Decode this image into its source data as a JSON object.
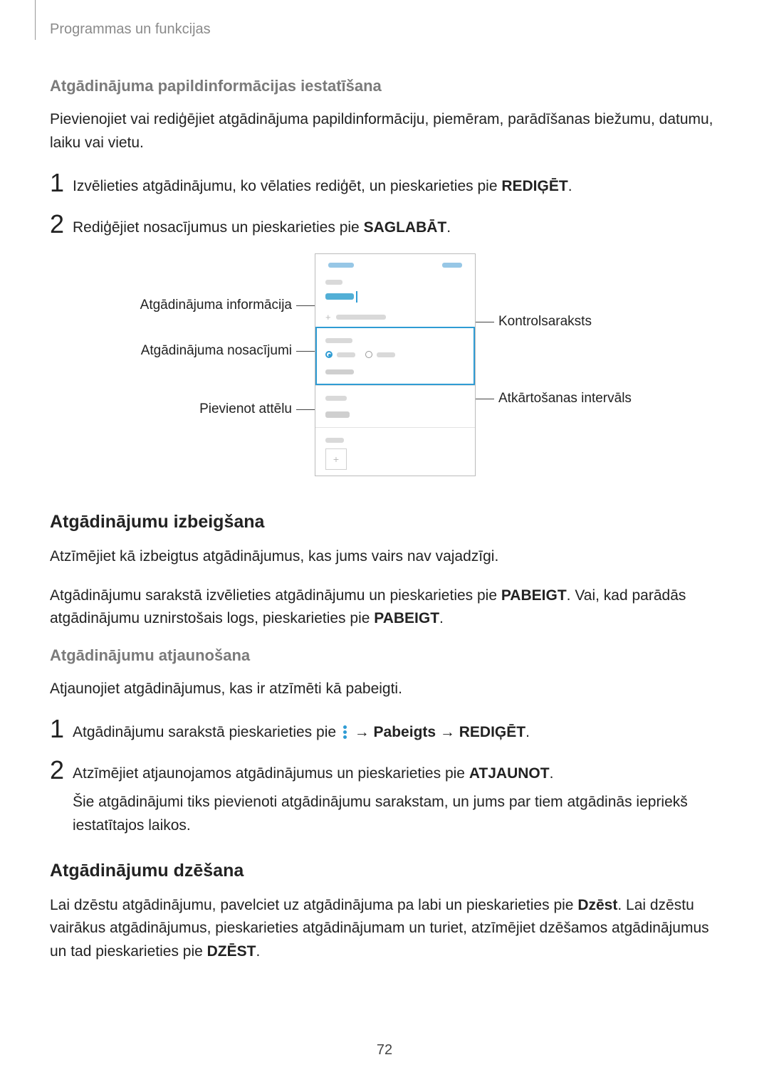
{
  "breadcrumb": "Programmas un funkcijas",
  "sec1": {
    "title": "Atgādinājuma papildinformācijas iestatīšana",
    "intro": "Pievienojiet vai rediģējiet atgādinājuma papildinformāciju, piemēram, parādīšanas biežumu, datumu, laiku vai vietu.",
    "step1_a": "Izvēlieties atgādinājumu, ko vēlaties rediģēt, un pieskarieties pie ",
    "step1_b": "REDIĢĒT",
    "step1_c": ".",
    "step2_a": "Rediģējiet nosacījumus un pieskarieties pie ",
    "step2_b": "SAGLABĀT",
    "step2_c": "."
  },
  "diagram": {
    "l1": "Atgādinājuma informācija",
    "l2": "Atgādinājuma nosacījumi",
    "l3": "Pievienot attēlu",
    "r1": "Kontrolsaraksts",
    "r2": "Atkārtošanas intervāls"
  },
  "sec2": {
    "title": "Atgādinājumu izbeigšana",
    "p1": "Atzīmējiet kā izbeigtus atgādinājumus, kas jums vairs nav vajadzīgi.",
    "p2_a": "Atgādinājumu sarakstā izvēlieties atgādinājumu un pieskarieties pie ",
    "p2_b": "PABEIGT",
    "p2_c": ". Vai, kad parādās atgādinājumu uznirstošais logs, pieskarieties pie ",
    "p2_d": "PABEIGT",
    "p2_e": "."
  },
  "sec3": {
    "title": "Atgādinājumu atjaunošana",
    "intro": "Atjaunojiet atgādinājumus, kas ir atzīmēti kā pabeigti.",
    "step1_a": "Atgādinājumu sarakstā pieskarieties pie ",
    "step1_arrow1": " → ",
    "step1_b": "Pabeigts",
    "step1_arrow2": " → ",
    "step1_c": "REDIĢĒT",
    "step1_d": ".",
    "step2_a": "Atzīmējiet atjaunojamos atgādinājumus un pieskarieties pie ",
    "step2_b": "ATJAUNOT",
    "step2_c": ".",
    "step2_sub": "Šie atgādinājumi tiks pievienoti atgādinājumu sarakstam, un jums par tiem atgādinās iepriekš iestatītajos laikos."
  },
  "sec4": {
    "title": "Atgādinājumu dzēšana",
    "p_a": "Lai dzēstu atgādinājumu, pavelciet uz atgādinājuma pa labi un pieskarieties pie ",
    "p_b": "Dzēst",
    "p_c": ". Lai dzēstu vairākus atgādinājumus, pieskarieties atgādinājumam un turiet, atzīmējiet dzēšamos atgādinājumus un tad pieskarieties pie ",
    "p_d": "DZĒST",
    "p_e": "."
  },
  "page_number": "72",
  "numbers": {
    "one": "1",
    "two": "2"
  }
}
